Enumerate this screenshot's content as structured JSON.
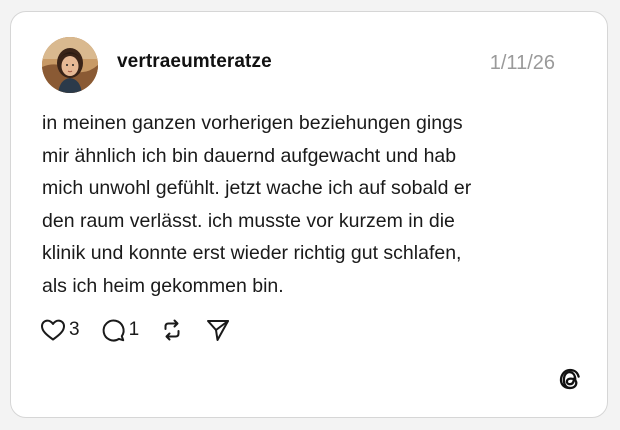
{
  "post": {
    "username": "vertraeumteratze",
    "date": "1/11/26",
    "text_lines": [
      "in meinen ganzen vorherigen beziehungen gings",
      "mir ähnlich ich bin dauernd aufgewacht und hab",
      "mich unwohl gefühlt. jetzt wache ich auf sobald er",
      "den raum verlässt. ich musste vor kurzem in die",
      "klinik und konnte erst wieder richtig gut schlafen,",
      "als ich heim gekommen bin."
    ]
  },
  "actions": {
    "like_count": "3",
    "reply_count": "1",
    "icons": [
      "heart-icon",
      "comment-icon",
      "repost-icon",
      "share-icon"
    ]
  },
  "brand": {
    "logo": "threads-logo-icon"
  }
}
